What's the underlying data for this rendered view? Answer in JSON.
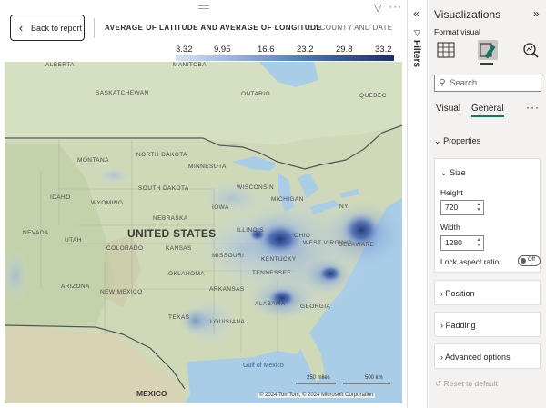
{
  "report": {
    "back_button_label": "Back to report",
    "visual_title": "AVERAGE OF LATITUDE AND AVERAGE OF LONGITUDE",
    "visual_subtitle": "BY COUNTY AND DATE",
    "filter_icon": "filter-icon",
    "more_options": "···"
  },
  "legend": {
    "values": [
      "3.32",
      "9.95",
      "16.6",
      "23.2",
      "29.8",
      "33.2"
    ],
    "colors": [
      "#d7e3f4",
      "#a6bfe6",
      "#6f92cf",
      "#3d5fae",
      "#1c2f6b"
    ]
  },
  "map": {
    "country_label": "UNITED STATES",
    "mexico_label": "MEXICO",
    "gulf_label": "Gulf of Mexico",
    "scale_miles": "250 miles",
    "scale_km": "500 km",
    "copyright": "© 2024 TomTom, © 2024 Microsoft Corporation",
    "labels": {
      "alberta": "ALBERTA",
      "manitoba": "MANITOBA",
      "saskatchewan": "SASKATCHEWAN",
      "ontario": "ONTARIO",
      "quebec": "QUEBEC",
      "montana": "MONTANA",
      "north_dakota": "NORTH DAKOTA",
      "minnesota": "MINNESOTA",
      "idaho": "IDAHO",
      "wyoming": "WYOMING",
      "south_dakota": "SOUTH DAKOTA",
      "wisconsin": "WISCONSIN",
      "michigan": "MICHIGAN",
      "ny": "NY",
      "nebraska": "NEBRASKA",
      "iowa": "IOWA",
      "nevada": "NEVADA",
      "utah": "UTAH",
      "colorado": "COLORADO",
      "kansas": "KANSAS",
      "illinois": "ILLINOIS",
      "ohio": "OHIO",
      "missouri": "MISSOURI",
      "west_virginia": "WEST VIRGINIA",
      "delaware": "DELAWARE",
      "kentucky": "KENTUCKY",
      "tennessee": "TENNESSEE",
      "oklahoma": "OKLAHOMA",
      "arizona": "ARIZONA",
      "new_mexico": "NEW MEXICO",
      "arkansas": "ARKANSAS",
      "alabama": "ALABAMA",
      "georgia": "GEORGIA",
      "texas": "TEXAS",
      "louisiana": "LOUISIANA"
    }
  },
  "filters": {
    "label": "Filters"
  },
  "viz_pane": {
    "title": "Visualizations",
    "format_visual": "Format visual",
    "search_placeholder": "Search",
    "tabs": [
      "Visual",
      "General"
    ],
    "active_tab": "General",
    "more": "···",
    "properties_label": "Properties",
    "size": {
      "label": "Size",
      "height_label": "Height",
      "height_value": "720",
      "width_label": "Width",
      "width_value": "1280",
      "lock_label": "Lock aspect ratio",
      "lock_state": "Off"
    },
    "sections": [
      "Position",
      "Padding",
      "Advanced options"
    ],
    "reset_label": "Reset to default"
  }
}
